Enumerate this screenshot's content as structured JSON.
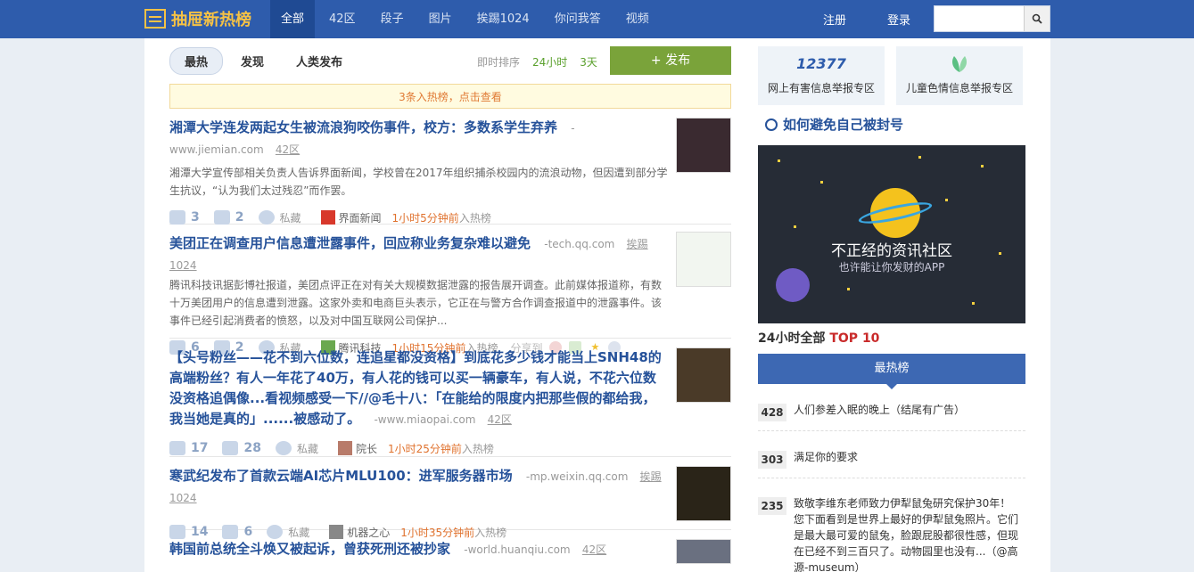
{
  "brand": {
    "name": "抽屉新热榜"
  },
  "nav": [
    {
      "label": "全部"
    },
    {
      "label": "42区"
    },
    {
      "label": "段子"
    },
    {
      "label": "图片"
    },
    {
      "label": "挨踢1024"
    },
    {
      "label": "你问我答"
    },
    {
      "label": "视频"
    }
  ],
  "auth": {
    "register": "注册",
    "login": "登录"
  },
  "search": {
    "placeholder": ""
  },
  "tabs": [
    {
      "label": "最热"
    },
    {
      "label": "发现"
    },
    {
      "label": "人类发布"
    }
  ],
  "sort": {
    "label": "即时排序",
    "h24": "24小时",
    "d3": "3天"
  },
  "publish": {
    "label": "+  发布"
  },
  "notice": "3条入热榜，点击查看",
  "items": [
    {
      "title": "湘潭大学连发两起女生被流浪狗咬伤事件，校方：多数系学生弃养",
      "domain": "-www.jiemian.com",
      "tag": "42区",
      "desc": "湘潭大学宣传部相关负责人告诉界面新闻，学校曾在2017年组织捕杀校园内的流浪动物，但因遭到部分学生抗议，“认为我们太过残忍”而作罢。",
      "likes": "3",
      "comments": "2",
      "collect": "私藏",
      "source": "界面新闻",
      "time": "1小时5分钟前",
      "time_suffix": "入热榜"
    },
    {
      "title": "美团正在调查用户信息遭泄露事件，回应称业务复杂难以避免",
      "domain": "-tech.qq.com",
      "tag": "挨踢1024",
      "desc": "腾讯科技讯据彭博社报道，美团点评正在对有关大规模数据泄露的报告展开调查。此前媒体报道称，有数十万美团用户的信息遭到泄露。这家外卖和电商巨头表示，它正在与警方合作调查报道中的泄露事件。该事件已经引起消费者的愤怒，以及对中国互联网公司保护...",
      "likes": "6",
      "comments": "2",
      "collect": "私藏",
      "source": "腾讯科技",
      "time": "1小时15分钟前",
      "time_suffix": "入热榜",
      "share": "分享到"
    },
    {
      "title": "【头号粉丝——花不到六位数，连追星都没资格】到底花多少钱才能当上SNH48的高端粉丝？有人一年花了40万，有人花的钱可以买一辆豪车，有人说，不花六位数没资格追偶像...看视频感受一下//@毛十八：「在能给的限度内把那些假的都给我，我当她是真的」......被感动了。",
      "domain": "-www.miaopai.com",
      "tag": "42区",
      "likes": "17",
      "comments": "28",
      "collect": "私藏",
      "source": "院长",
      "time": "1小时25分钟前",
      "time_suffix": "入热榜"
    },
    {
      "title": "寒武纪发布了首款云端AI芯片MLU100：进军服务器市场",
      "domain": "-mp.weixin.qq.com",
      "tag": "挨踢1024",
      "likes": "14",
      "comments": "6",
      "collect": "私藏",
      "source": "机器之心",
      "time": "1小时35分钟前",
      "time_suffix": "入热榜"
    },
    {
      "title": "韩国前总统全斗焕又被起诉，曾获死刑还被抄家",
      "domain": "-world.huanqiu.com",
      "tag": "42区"
    }
  ],
  "reports": [
    {
      "label": "网上有害信息举报专区",
      "icon": "12377"
    },
    {
      "label": "儿童色情信息举报专区",
      "icon": "leaf"
    }
  ],
  "avoid": "如何避免自己被封号",
  "banner": {
    "line1": "不正经的资讯社区",
    "line2": "也许能让你发财的APP"
  },
  "top10": {
    "prefix": "24小时全部 ",
    "highlight": "TOP 10"
  },
  "hot_tab": "最热榜",
  "ranks": [
    {
      "num": "428",
      "text": "人们参差入眠的晚上（结尾有广告）"
    },
    {
      "num": "303",
      "text": "满足你的要求"
    },
    {
      "num": "235",
      "text": "致敬李维东老师致力伊犁鼠兔研究保护30年！您下面看到是世界上最好的伊犁鼠兔照片。它们是最大最可爱的鼠兔，脸跟屁股都很性感，但现在已经不到三百只了。动物园里也没有...（@高源-museum）"
    }
  ]
}
